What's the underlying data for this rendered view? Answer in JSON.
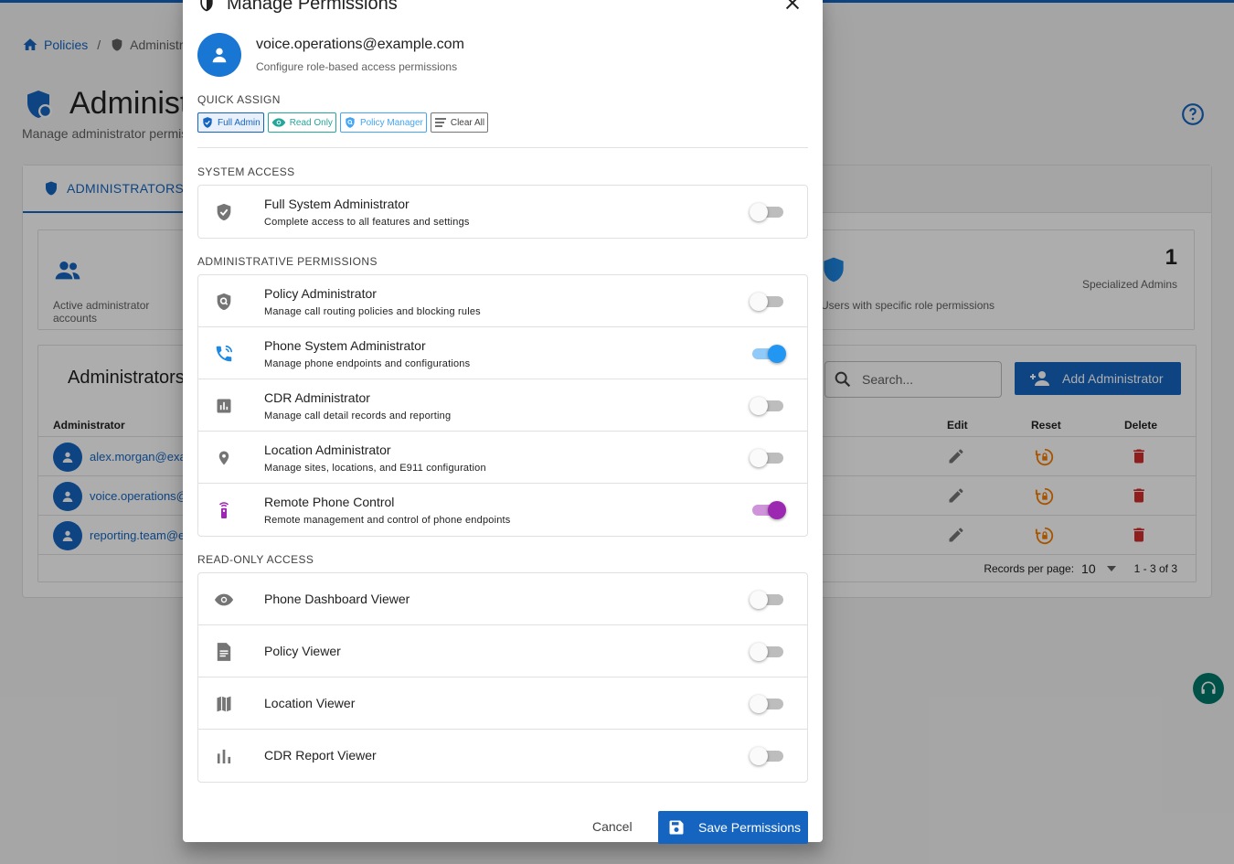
{
  "background": {
    "breadcrumb": {
      "home": "Policies",
      "separator": "/",
      "current": "Administrators"
    },
    "page_title": "Administrators",
    "page_subtitle": "Manage administrator permissions",
    "tab_label": "ADMINISTRATORS",
    "stats": {
      "left_label": "Active administrator accounts",
      "right_label": "Users with specific role permissions",
      "right_value": "1",
      "right_value_label": "Specialized Admins"
    },
    "list": {
      "title": "Administrators",
      "search_placeholder": "Search...",
      "add_button": "Add Administrator",
      "columns": {
        "admin": "Administrator",
        "edit": "Edit",
        "reset": "Reset",
        "delete": "Delete"
      },
      "rows": [
        {
          "email": "alex.morgan@example.com"
        },
        {
          "email": "voice.operations@example.com"
        },
        {
          "email": "reporting.team@example.com"
        }
      ],
      "pager": {
        "label": "Records per page:",
        "per_page": "10",
        "range": "1 - 3 of 3"
      }
    }
  },
  "dialog": {
    "title": "Manage Permissions",
    "user_email": "voice.operations@example.com",
    "user_subtitle": "Configure role-based access permissions",
    "quick_assign": {
      "label": "QUICK ASSIGN",
      "chips": [
        "Full Admin",
        "Read Only",
        "Policy Manager",
        "Clear All"
      ]
    },
    "system_access": {
      "label": "SYSTEM ACCESS",
      "items": [
        {
          "title": "Full System Administrator",
          "desc": "Complete access to all features and settings",
          "enabled": false
        }
      ]
    },
    "admin_permissions": {
      "label": "ADMINISTRATIVE PERMISSIONS",
      "items": [
        {
          "title": "Policy Administrator",
          "desc": "Manage call routing policies and blocking rules",
          "enabled": false
        },
        {
          "title": "Phone System Administrator",
          "desc": "Manage phone endpoints and configurations",
          "enabled": true
        },
        {
          "title": "CDR Administrator",
          "desc": "Manage call detail records and reporting",
          "enabled": false
        },
        {
          "title": "Location Administrator",
          "desc": "Manage sites, locations, and E911 configuration",
          "enabled": false
        },
        {
          "title": "Remote Phone Control",
          "desc": "Remote management and control of phone endpoints",
          "enabled": true
        }
      ]
    },
    "read_only": {
      "label": "READ-ONLY ACCESS",
      "items": [
        {
          "title": "Phone Dashboard Viewer",
          "enabled": false
        },
        {
          "title": "Policy Viewer",
          "enabled": false
        },
        {
          "title": "Location Viewer",
          "enabled": false
        },
        {
          "title": "CDR Report Viewer",
          "enabled": false
        }
      ]
    },
    "cancel_label": "Cancel",
    "save_label": "Save Permissions"
  },
  "colors": {
    "primary": "#1565c0",
    "switch_blue": "#2196f3",
    "switch_purple": "#9c27b0",
    "danger": "#d32f2f",
    "reset": "#f57c00"
  }
}
